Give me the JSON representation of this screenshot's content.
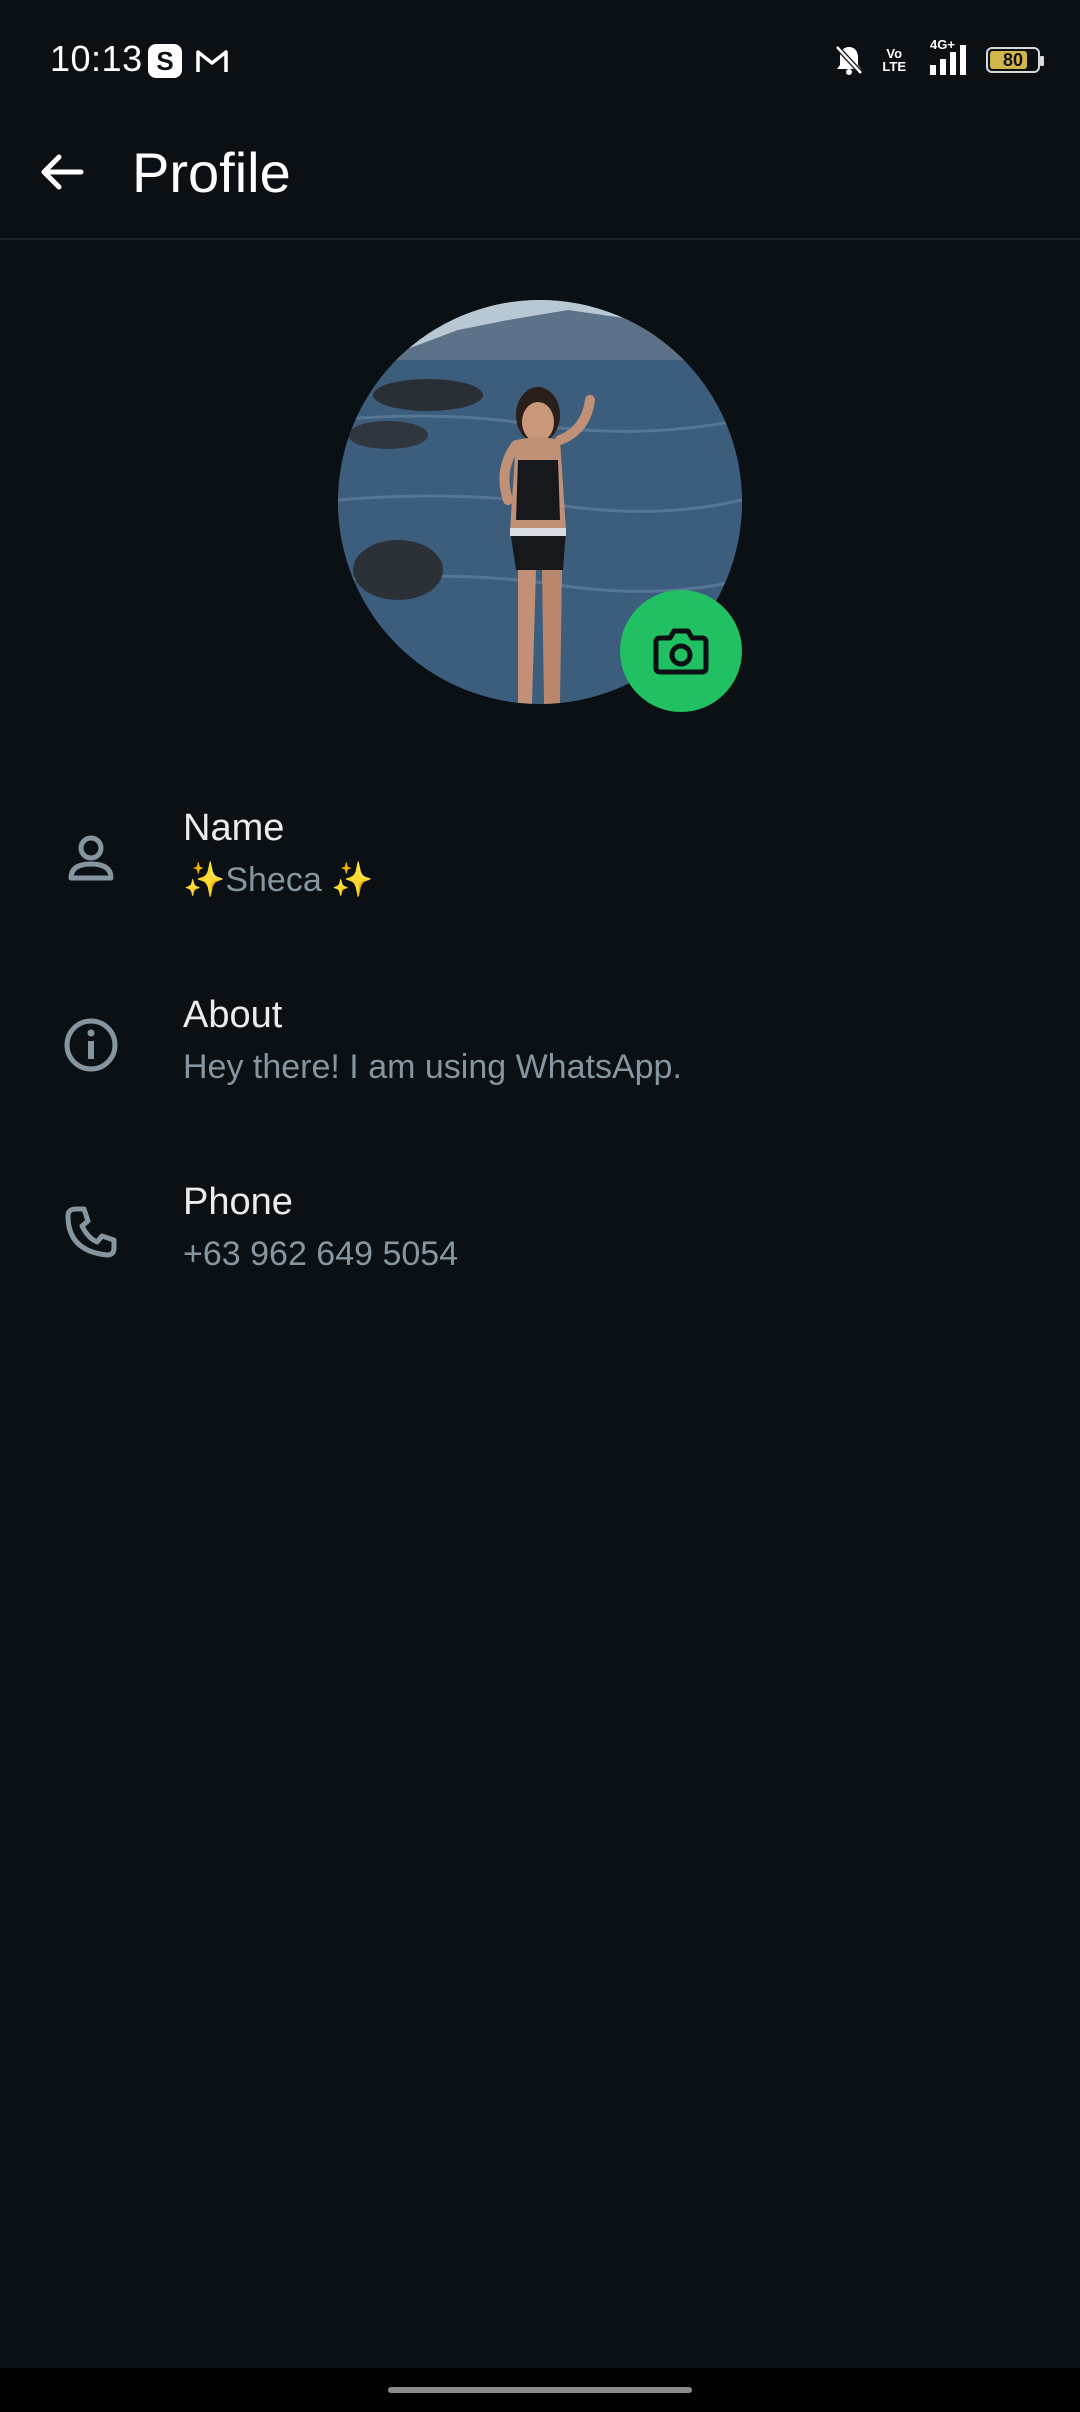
{
  "status_bar": {
    "time": "10:13",
    "app_icon_s": "S",
    "battery_level": "80",
    "network": "4G+",
    "volte_line1": "Vo",
    "volte_line2": "LTE",
    "icons": [
      "s-app-icon",
      "gmail-icon",
      "bell-off-icon",
      "volte-icon",
      "signal-icon",
      "battery-icon"
    ]
  },
  "header": {
    "title": "Profile"
  },
  "avatar": {
    "alt": "profile photo",
    "camera_icon": "camera-icon",
    "accent_color": "#21c063"
  },
  "rows": [
    {
      "icon": "person-icon",
      "label": "Name",
      "value": "✨Sheca ✨"
    },
    {
      "icon": "info-icon",
      "label": "About",
      "value": "Hey there! I am using WhatsApp."
    },
    {
      "icon": "phone-icon",
      "label": "Phone",
      "value": "+63 962 649 5054"
    }
  ],
  "colors": {
    "background": "#0b1014",
    "primary_text": "#e9edef",
    "secondary_text": "#8696a0",
    "accent": "#21c063"
  }
}
